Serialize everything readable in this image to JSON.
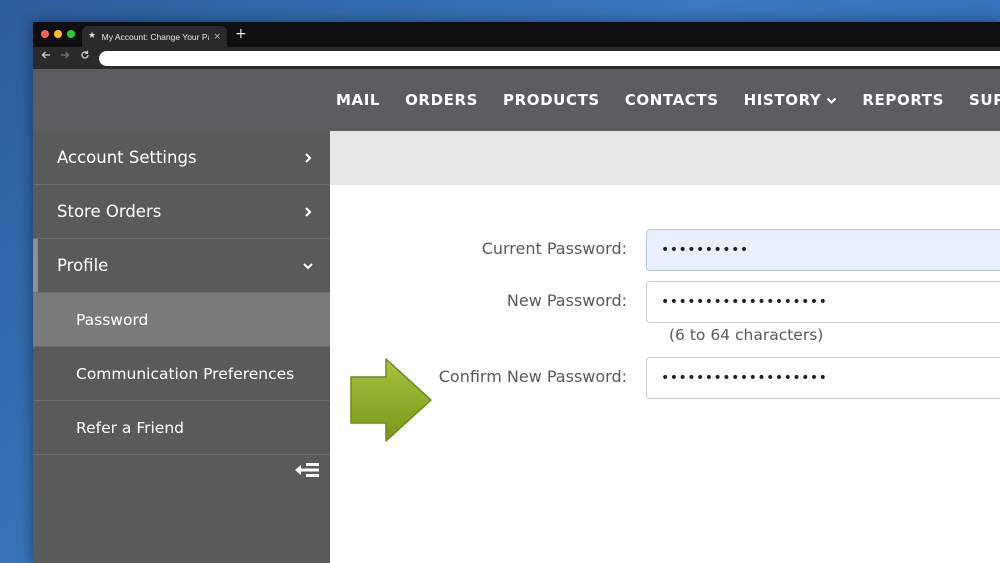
{
  "browser": {
    "tab_title": "My Account: Change Your Password",
    "tab_close": "×",
    "new_tab": "+"
  },
  "topnav": {
    "items": [
      "MAIL",
      "ORDERS",
      "PRODUCTS",
      "CONTACTS",
      "HISTORY",
      "REPORTS",
      "SUPPLI"
    ]
  },
  "sidebar": {
    "items": [
      {
        "label": "Account Settings"
      },
      {
        "label": "Store Orders"
      },
      {
        "label": "Profile"
      }
    ],
    "subitems": [
      {
        "label": "Password"
      },
      {
        "label": "Communication Preferences"
      },
      {
        "label": "Refer a Friend"
      }
    ]
  },
  "form": {
    "current_label": "Current Password:",
    "current_value": "••••••••••",
    "new_label": "New Password:",
    "new_value": "•••••••••••••••••••",
    "hint": "(6 to 64 characters)",
    "confirm_label": "Confirm New Password:",
    "confirm_value": "•••••••••••••••••••"
  },
  "colors": {
    "header_bg": "#5b5d61",
    "sidebar_bg": "#5a5a5a",
    "selected_bg": "#7a7a7a",
    "arrow_green": "#8db02a",
    "focused_input_bg": "#e8f0fe"
  },
  "icons": {
    "back": "arrow-left",
    "forward": "arrow-right",
    "reload": "reload",
    "collapse": "collapse-sidebar",
    "pointer": "green-arrow"
  }
}
